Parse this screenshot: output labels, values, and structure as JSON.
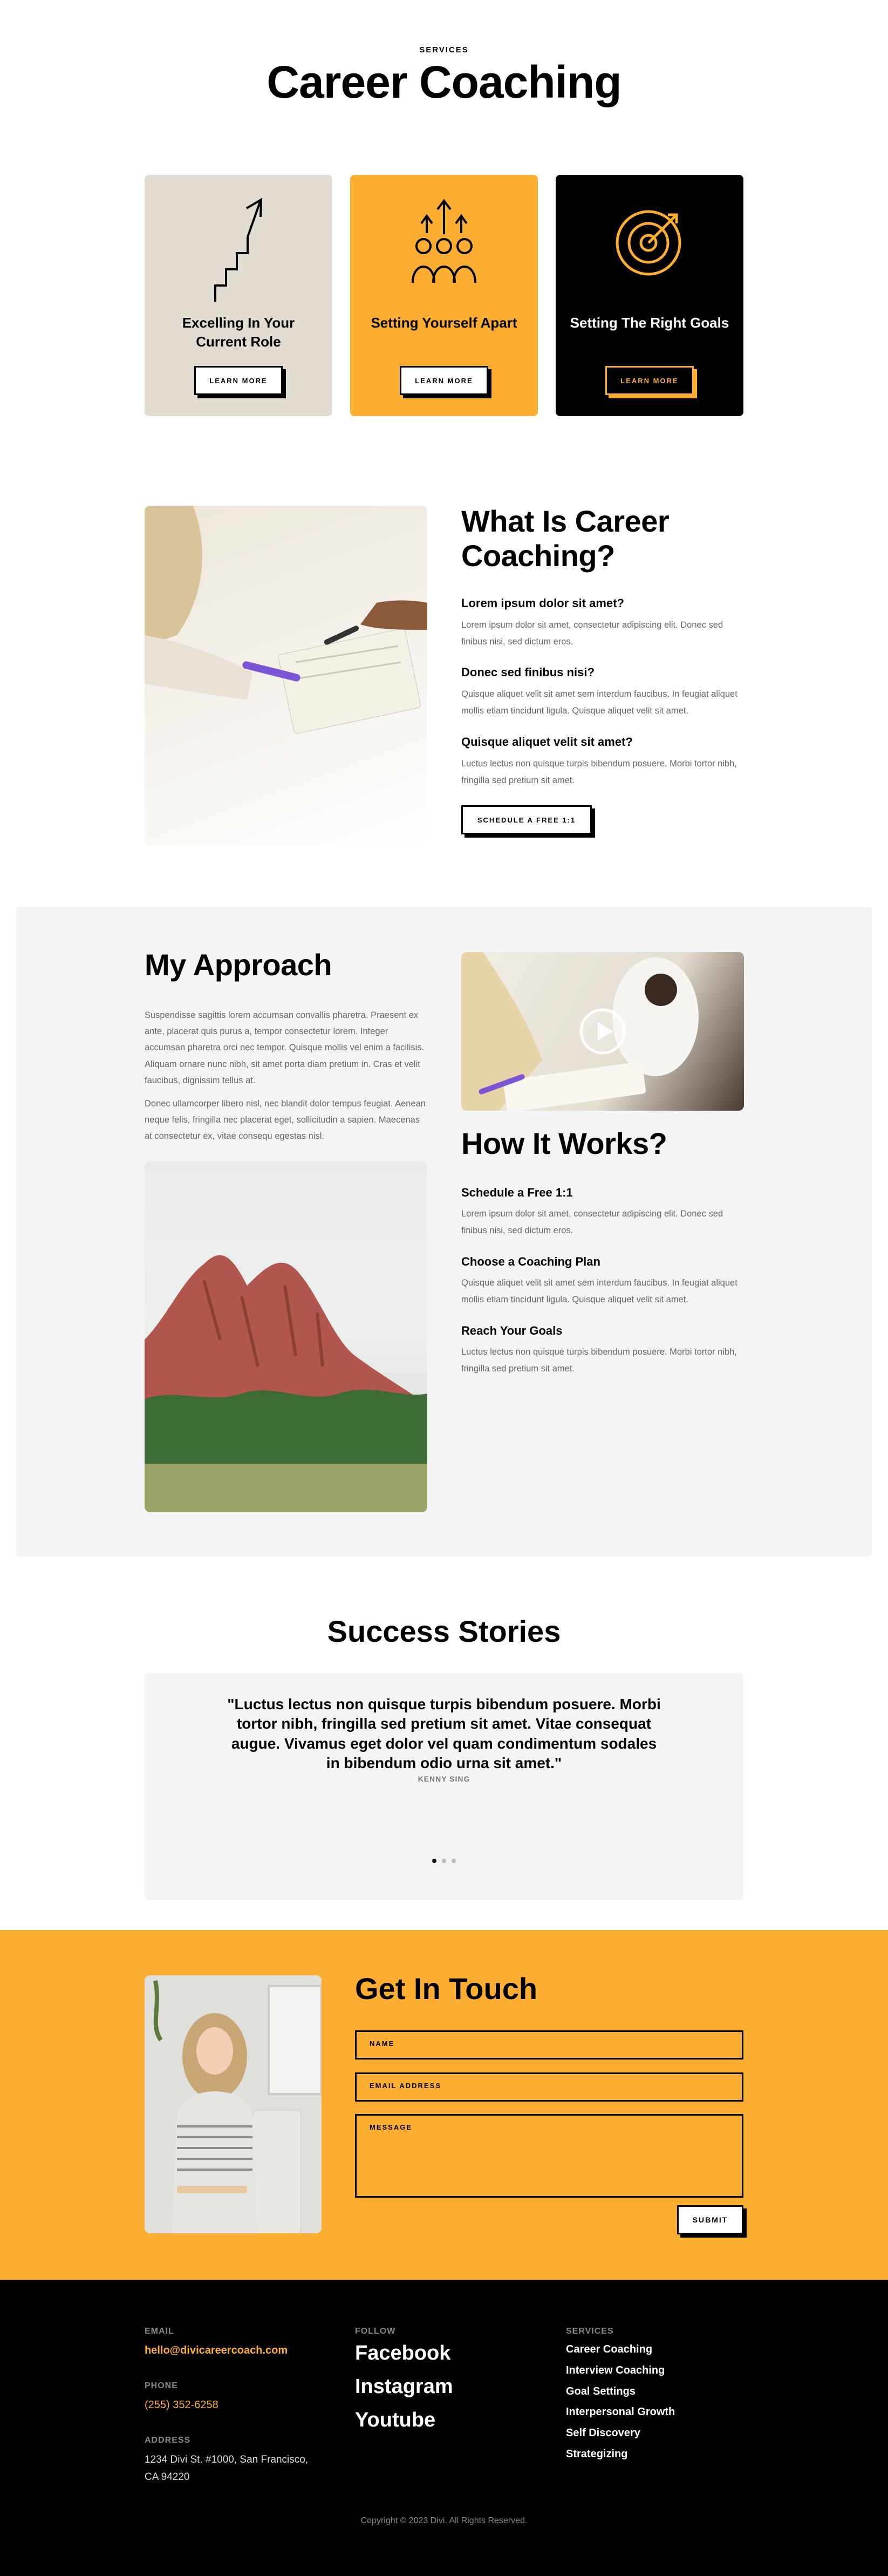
{
  "hero": {
    "eyebrow": "SERVICES",
    "title": "Career Coaching"
  },
  "services": [
    {
      "title": "Excelling In Your Current Role",
      "button": "LEARN MORE",
      "icon": "stairs-arrow-icon",
      "bg": "#e3dcd1",
      "fg": "#000000"
    },
    {
      "title": "Setting Yourself Apart",
      "button": "LEARN MORE",
      "icon": "team-arrows-icon",
      "bg": "#fbae32",
      "fg": "#000000"
    },
    {
      "title": "Setting The Right Goals",
      "button": "LEARN MORE",
      "icon": "target-icon",
      "bg": "#000000",
      "fg": "#ffffff"
    }
  ],
  "what_is": {
    "title": "What Is Career Coaching?",
    "items": [
      {
        "q": "Lorem ipsum dolor sit amet?",
        "a": "Lorem ipsum dolor sit amet, consectetur adipiscing elit. Donec sed finibus nisi, sed dictum eros."
      },
      {
        "q": "Donec sed finibus nisi?",
        "a": "Quisque aliquet velit sit amet sem interdum faucibus. In feugiat aliquet mollis etiam tincidunt ligula. Quisque aliquet velit sit amet."
      },
      {
        "q": "Quisque aliquet velit sit amet?",
        "a": "Luctus lectus non quisque turpis bibendum posuere. Morbi tortor nibh, fringilla sed pretium sit amet."
      }
    ],
    "button": "SCHEDULE A FREE 1:1"
  },
  "approach": {
    "title": "My Approach",
    "p1": "Suspendisse sagittis lorem accumsan convallis pharetra. Praesent ex ante, placerat quis purus a, tempor consectetur lorem. Integer accumsan pharetra orci nec tempor. Quisque mollis vel enim a facilisis. Aliquam ornare nunc nibh, sit amet porta diam pretium in. Cras et velit faucibus, dignissim tellus at.",
    "p2": "Donec ullamcorper libero nisl, nec blandit dolor tempus feugiat. Aenean neque felis, fringilla nec placerat eget, sollicitudin a sapien. Maecenas at consectetur ex, vitae consequ egestas nisl."
  },
  "how": {
    "title": "How It Works?",
    "items": [
      {
        "q": "Schedule a Free 1:1",
        "a": "Lorem ipsum dolor sit amet, consectetur adipiscing elit. Donec sed finibus nisi, sed dictum eros."
      },
      {
        "q": "Choose a Coaching Plan",
        "a": "Quisque aliquet velit sit amet sem interdum faucibus. In feugiat aliquet mollis etiam tincidunt ligula. Quisque aliquet velit sit amet."
      },
      {
        "q": "Reach Your Goals",
        "a": "Luctus lectus non quisque turpis bibendum posuere. Morbi tortor nibh, fringilla sed pretium sit amet."
      }
    ]
  },
  "success": {
    "title": "Success Stories",
    "quote": "\"Luctus lectus non quisque turpis bibendum posuere. Morbi tortor nibh, fringilla sed pretium sit amet. Vitae consequat augue. Vivamus eget dolor vel quam condimentum sodales in bibendum odio urna sit amet.\"",
    "author": "KENNY SING"
  },
  "contact": {
    "title": "Get In Touch",
    "name_placeholder": "NAME",
    "email_placeholder": "EMAIL ADDRESS",
    "message_placeholder": "MESSAGE",
    "submit": "SUBMIT"
  },
  "footer": {
    "email_label": "EMAIL",
    "email": "hello@divicareercoach.com",
    "phone_label": "PHONE",
    "phone": "(255) 352-6258",
    "address_label": "ADDRESS",
    "address_line1": "1234 Divi St. #1000, San Francisco,",
    "address_line2": "CA 94220",
    "follow_label": "FOLLOW",
    "social": [
      "Facebook",
      "Instagram",
      "Youtube"
    ],
    "services_label": "SERVICES",
    "services": [
      "Career Coaching",
      "Interview Coaching",
      "Goal Settings",
      "Interpersonal Growth",
      "Self Discovery",
      "Strategizing"
    ],
    "copyright": "Copyright © 2023 Divi. All Rights Reserved."
  },
  "colors": {
    "accent": "#fbae32",
    "beige": "#e3dcd1",
    "gray_bg": "#f4f4f4"
  }
}
